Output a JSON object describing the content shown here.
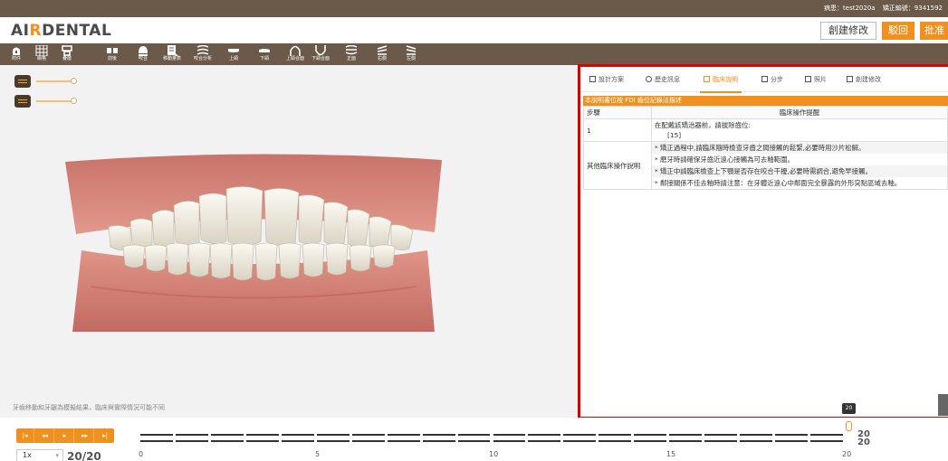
{
  "account": {
    "patient_label": "病患：test2020a",
    "case_label": "矯正編號：9341592"
  },
  "brand": {
    "logo_prefix": "AI",
    "logo_a": "R",
    "logo_rest": "DENTAL"
  },
  "header": {
    "create_modify": "創建修改",
    "return": "駁回",
    "approve": "批准"
  },
  "toolbar": [
    {
      "label": "附件",
      "icon": "attachment-icon"
    },
    {
      "label": "網格",
      "icon": "grid-icon"
    },
    {
      "label": "疊層",
      "icon": "overlay-icon"
    },
    {
      "label": "前後",
      "icon": "before-after-icon"
    },
    {
      "label": "咬合",
      "icon": "bite-icon"
    },
    {
      "label": "移動量表",
      "icon": "movement-table-icon"
    },
    {
      "label": "咬合分析",
      "icon": "occlusion-analysis-icon"
    },
    {
      "label": "上頜",
      "icon": "upper-jaw-icon"
    },
    {
      "label": "下頜",
      "icon": "lower-jaw-icon"
    },
    {
      "label": "上頜合面",
      "icon": "upper-occlusal-icon"
    },
    {
      "label": "下頜合面",
      "icon": "lower-occlusal-icon"
    },
    {
      "label": "正面",
      "icon": "front-view-icon"
    },
    {
      "label": "右側",
      "icon": "right-view-icon"
    },
    {
      "label": "左側",
      "icon": "left-view-icon"
    }
  ],
  "viewer": {
    "disclaimer": "牙齒移動和牙齦為模擬結果，臨床與實際情況可能不同"
  },
  "tabs": [
    {
      "label": "設計方案",
      "icon": "document-icon"
    },
    {
      "label": "歷史訊息",
      "icon": "history-icon"
    },
    {
      "label": "臨床說明",
      "icon": "clinical-icon",
      "active": true
    },
    {
      "label": "分步",
      "icon": "steps-icon"
    },
    {
      "label": "照片",
      "icon": "photo-icon"
    },
    {
      "label": "創建修改",
      "icon": "edit-icon"
    }
  ],
  "clinical": {
    "section_title": "本說明書位按 FDI 齒位記錄法描述",
    "col_step": "步驟",
    "col_op": "臨床操作提醒",
    "row1_step": "1",
    "row1_text": "在配戴該矯治器前，請拔除齒位:",
    "row1_teeth": "[15]",
    "row2_label": "其他臨床操作說明",
    "row2_lines": [
      "* 矯正過程中,請臨床隨時檢查牙齒之間接觸的鬆緊,必要時用沙片松解。",
      "* 磨牙時請確保牙齒近遠心接觸為可去釉範圍。",
      "* 矯正中請臨床檢查上下顎是否存在咬合干擾,必要時需調合,避免早接觸。",
      "* 鄰接關係不佳去釉時請注意：在牙體近遠心中鄰面完全暴露的外形突點區域去釉。"
    ]
  },
  "panel_badge": "20",
  "timeline": {
    "speed": "1x",
    "counter": "20/20",
    "ticks": [
      "0",
      "5",
      "10",
      "15",
      "20"
    ],
    "right_top": "20",
    "right_bottom": "20"
  },
  "colors": {
    "accent": "#f0901e",
    "toolbar": "#6b5a4a",
    "highlight": "#e00000",
    "gum": "#d98a7c",
    "tooth": "#f4f1e8"
  }
}
